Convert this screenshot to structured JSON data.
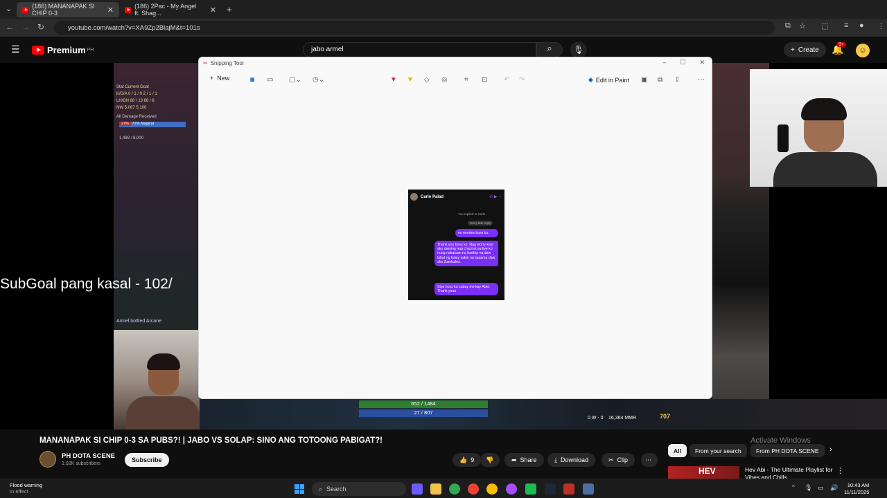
{
  "browser": {
    "tabs": [
      {
        "label": "(186) MANANAPAK SI CHIP 0-3"
      },
      {
        "label": "(186) 2Pac - My Angel ft. Shag..."
      }
    ],
    "url": "youtube.com/watch?v=XA9Zp2BlajM&t=101s"
  },
  "youtube": {
    "logo": "Premium",
    "region": "PH",
    "search_query": "jabo armel",
    "create_label": "Create",
    "notif_badge": "9+"
  },
  "video": {
    "overlay_subgoal": "SubGoal pang kasal - 102/",
    "stats_header": "Stat  Current  Goal",
    "stats_rows": [
      "K/D/A  0 / 1 / 0   2 / 1 / 1",
      "LH/DN  88 / 13   68 / 6",
      "NW  5,087   5,100"
    ],
    "damage_label": "All Damage Received",
    "damage_pct": "27%",
    "damage_bar": "72% Magical",
    "bounty": "1,489 / 8,000",
    "chat_line": "Armel bottled Arcane",
    "hp": "652 / 1484",
    "mp": "27 / 807",
    "score": "0 W - 0",
    "mmr": "16,364 MMR",
    "gold": "707"
  },
  "snipping_tool": {
    "title": "Snipping Tool",
    "new_label": "New",
    "edit_in_paint": "Edit in Paint",
    "chat": {
      "contact": "Carlo Palad",
      "replied": "You replied to Carlo",
      "late_reply": "Sorry late reply",
      "msg1": "no worries boss ku.",
      "msg2": "Thank you boss ku. Nag worry kasi ako daming nag chachat sa live ko nung nakaraan na badtrip na daw lahat ng kulay sakin na sasama daw ako Zambales.",
      "msg3": "Sige boss ku sabay me kay Abet. Thank youu"
    }
  },
  "watch": {
    "title": "MANANAPAK SI CHIP 0-3 SA PUBS?! | JABO VS SOLAP: SINO ANG TOTOONG PABIGAT?!",
    "channel": "PH DOTA SCENE",
    "subs": "1.02K subscribers",
    "subscribe": "Subscribe",
    "likes": "9",
    "share": "Share",
    "download": "Download",
    "clip": "Clip",
    "chips": [
      "All",
      "From your search",
      "From PH DOTA SCENE"
    ],
    "activate": "Activate Windows",
    "rec_title": "Hev Abi - The Ultimate Playlist for Vibes and Chills",
    "rec_thumb_text": "HEV"
  },
  "taskbar": {
    "weather_title": "Flood warning",
    "weather_sub": "In effect",
    "search": "Search",
    "time": "10:43 AM",
    "date": "11/11/2025"
  },
  "colors": {
    "yt_red": "#ff0000",
    "messenger_purple": "#7b2ff7",
    "win_blue": "#3aa0ff"
  }
}
